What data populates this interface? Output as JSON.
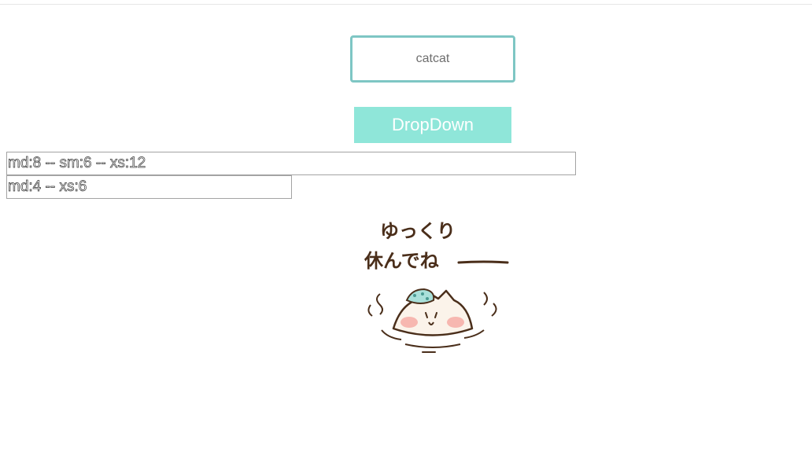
{
  "catcat_box": {
    "label": "catcat"
  },
  "dropdown": {
    "label": "DropDown"
  },
  "columns": [
    {
      "label": "md:8 -- sm:6 -- xs:12"
    },
    {
      "label": "md:4 -- xs:6"
    }
  ],
  "sticker": {
    "line1": "ゆっくり",
    "line2": "休んでね",
    "icon": "cat-in-bath-sticker"
  },
  "colors": {
    "accent_border": "#7ec6c4",
    "dropdown_bg": "#8fe6d9",
    "sticker_ink": "#4a2e1a",
    "towel": "#a9e0da",
    "blush": "#f7b7b0"
  }
}
